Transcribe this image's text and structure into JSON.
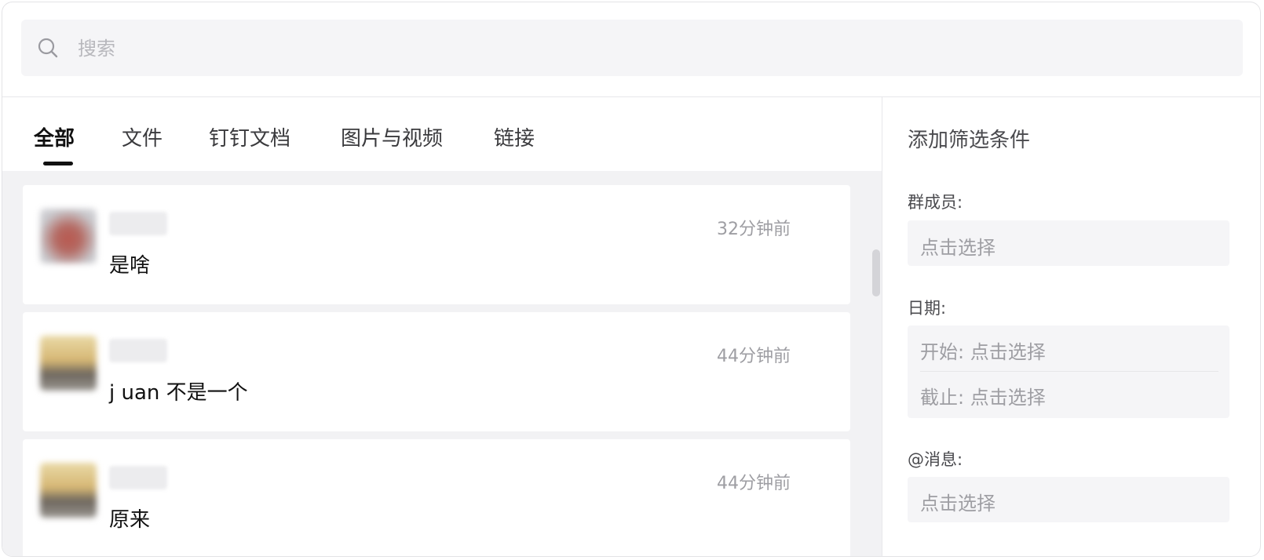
{
  "search": {
    "placeholder": "搜索",
    "icon": "search-icon"
  },
  "tabs": [
    {
      "label": "全部",
      "active": true
    },
    {
      "label": "文件",
      "active": false
    },
    {
      "label": "钉钉文档",
      "active": false
    },
    {
      "label": "图片与视频",
      "active": false
    },
    {
      "label": "链接",
      "active": false
    }
  ],
  "messages": [
    {
      "text": "是啥",
      "time": "32分钟前"
    },
    {
      "text": "j uan 不是一个",
      "time": "44分钟前"
    },
    {
      "text": "原来",
      "time": "44分钟前"
    }
  ],
  "filters": {
    "title": "添加筛选条件",
    "members": {
      "label": "群成员:",
      "placeholder": "点击选择"
    },
    "date": {
      "label": "日期:",
      "start": "开始: 点击选择",
      "end": "截止: 点击选择"
    },
    "mentions": {
      "label": "@消息:",
      "placeholder": "点击选择"
    }
  }
}
